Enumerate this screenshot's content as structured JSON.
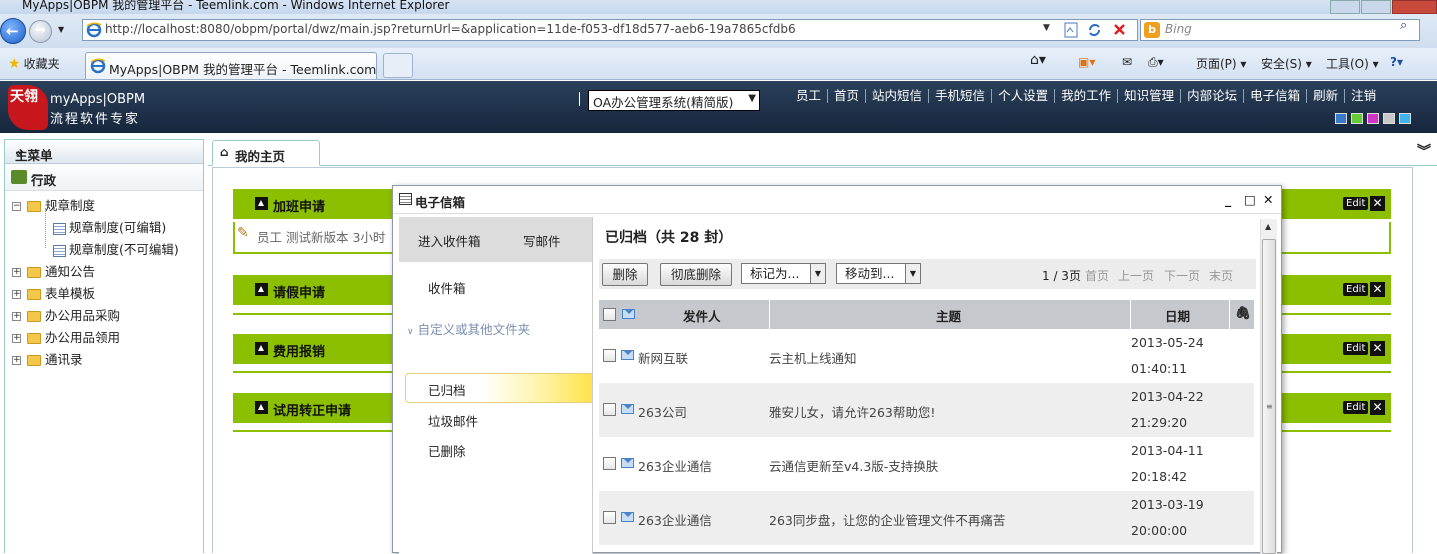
{
  "browser": {
    "window_title": "MyApps|OBPM 我的管理平台 - Teemlink.com - Windows Internet Explorer",
    "url": "http://localhost:8080/obpm/portal/dwz/main.jsp?returnUrl=&application=11de-f053-df18d577-aeb6-19a7865cfdb6",
    "search_placeholder": "Bing",
    "favorites_label": "收藏夹",
    "tab_title": "MyApps|OBPM 我的管理平台 - Teemlink.com",
    "commands": {
      "page": "页面(P)",
      "safety": "安全(S)",
      "tools": "工具(O)"
    }
  },
  "header": {
    "logo_text": "天翎",
    "brand_line1": "myApps|OBPM",
    "brand_line2": "流程软件专家",
    "system_select": "OA办公管理系统(精简版)",
    "nav": [
      "员工",
      "首页",
      "站内短信",
      "手机短信",
      "个人设置",
      "我的工作",
      "知识管理",
      "内部论坛",
      "电子信箱",
      "刷新",
      "注销"
    ],
    "theme_colors": [
      "#3a78c8",
      "#66cc33",
      "#d433c8",
      "#c8c8c8",
      "#3fb6f0"
    ]
  },
  "sidebar": {
    "title": "主菜单",
    "group": "行政",
    "items": [
      {
        "label": "规章制度"
      },
      {
        "label": "规章制度(可编辑)"
      },
      {
        "label": "规章制度(不可编辑)"
      },
      {
        "label": "通知公告"
      },
      {
        "label": "表单模板"
      },
      {
        "label": "办公用品采购"
      },
      {
        "label": "办公用品领用"
      },
      {
        "label": "通讯录"
      }
    ]
  },
  "main": {
    "home_tab": "我的主页",
    "portlets": [
      {
        "title": "加班申请",
        "edit": "Edit"
      },
      {
        "title": "请假申请",
        "edit": "Edit"
      },
      {
        "title": "费用报销",
        "edit": "Edit"
      },
      {
        "title": "试用转正申请",
        "edit": "Edit"
      }
    ],
    "portlet_row": "员工  测试新版本  3小时"
  },
  "email": {
    "window_title": "电子信箱",
    "enter_inbox": "进入收件箱",
    "compose": "写邮件",
    "inbox": "收件箱",
    "custom_folders": "自定义或其他文件夹",
    "folders": [
      "已归档",
      "垃圾邮件",
      "已删除"
    ],
    "mailbox_title": "已归档（共 28 封）",
    "toolbar": {
      "delete": "删除",
      "purge": "彻底删除",
      "mark_as": "标记为...",
      "move_to": "移动到...",
      "page_info": "1 / 3页",
      "first": "首页",
      "prev": "上一页",
      "next": "下一页",
      "last": "末页"
    },
    "columns": {
      "sender": "发件人",
      "subject": "主题",
      "date": "日期"
    },
    "messages": [
      {
        "from": "新网互联",
        "subject": "云主机上线通知",
        "date": "2013-05-24",
        "time": "01:40:11"
      },
      {
        "from": "263公司",
        "subject": "雅安儿女，请允许263帮助您!",
        "date": "2013-04-22",
        "time": "21:29:20"
      },
      {
        "from": "263企业通信",
        "subject": "云通信更新至v4.3版-支持换肤",
        "date": "2013-04-11",
        "time": "20:18:42"
      },
      {
        "from": "263企业通信",
        "subject": "263同步盘，让您的企业管理文件不再痛苦",
        "date": "2013-03-19",
        "time": "20:00:00"
      }
    ]
  }
}
